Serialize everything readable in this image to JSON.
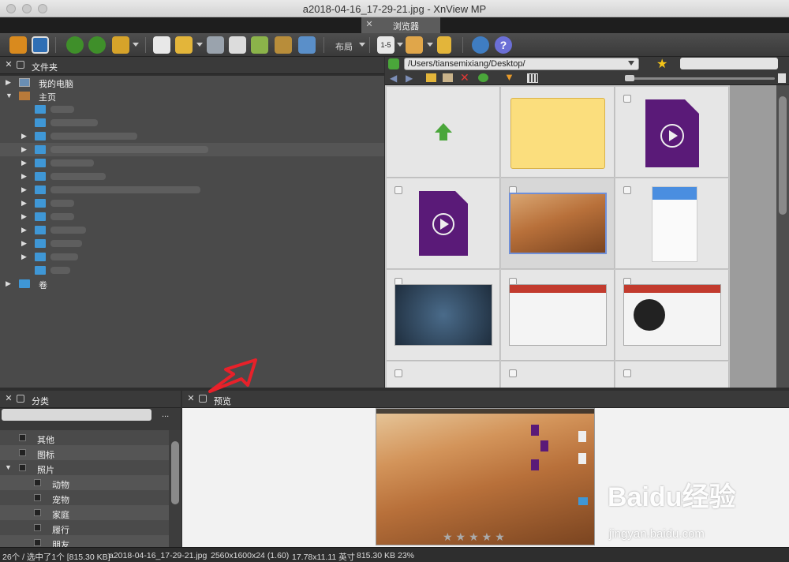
{
  "window": {
    "title": "a2018-04-16_17-29-21.jpg - XnView MP"
  },
  "tabs": [
    {
      "label": "浏览器"
    }
  ],
  "toolbar": {
    "layout_label": "布局",
    "page_label": "1-5"
  },
  "folders_pane": {
    "title": "文件夹",
    "items": [
      {
        "label": "我的电脑"
      },
      {
        "label": "主页"
      },
      {
        "label": "卷"
      }
    ]
  },
  "browser": {
    "path": "/Users/tiansemixiang/Desktop/"
  },
  "categories_pane": {
    "title": "分类",
    "search_button": "...",
    "items": [
      {
        "label": "其他",
        "level": 0
      },
      {
        "label": "图标",
        "level": 0
      },
      {
        "label": "照片",
        "level": 0
      },
      {
        "label": "动物",
        "level": 1
      },
      {
        "label": "宠物",
        "level": 1
      },
      {
        "label": "家庭",
        "level": 1
      },
      {
        "label": "履行",
        "level": 1
      },
      {
        "label": "朋友",
        "level": 1
      }
    ]
  },
  "preview_pane": {
    "title": "预览"
  },
  "status": {
    "selection": "26个 / 选中了1个 [815.30 KB]",
    "filename": "a2018-04-16_17-29-21.jpg",
    "dimensions": "2560x1600x24 (1.60)",
    "print_size": "17.78x11.11 英寸",
    "filesize": "815.30 KB",
    "zoom": "23%"
  },
  "watermark": {
    "brand": "Baidu经验",
    "url": "jingyan.baidu.com"
  },
  "colors": {
    "accent_folder": "#3f97d6",
    "dark_bg": "#2e2e2e",
    "video_purple": "#5a1a78"
  }
}
